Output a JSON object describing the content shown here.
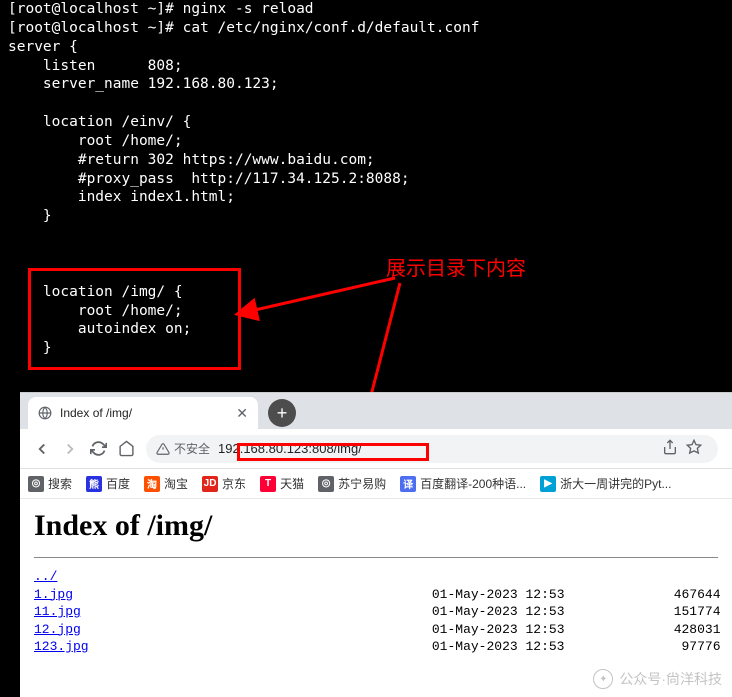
{
  "terminal": {
    "line0": "[root@localhost ~]# nginx -s reload",
    "prompt": "[root@localhost ~]# ",
    "command": "cat /etc/nginx/conf.d/default.conf",
    "config": "\nserver {\n    listen      808;\n    server_name 192.168.80.123;\n\n    location /einv/ {\n        root /home/;\n        #return 302 https://www.baidu.com;\n        #proxy_pass  http://117.34.125.2:8088;\n        index index1.html;\n    }\n\n\n\n    location /img/ {\n        root /home/;\n        autoindex on;\n    }"
  },
  "annotation": {
    "text": "展示目录下内容"
  },
  "browser": {
    "tab_title": "Index of /img/",
    "insecure_label": "不安全",
    "url": "192.168.80.123:808/img/",
    "bookmarks": [
      {
        "label": "搜索",
        "icon_bg": "#5f6368",
        "icon_txt": "◎"
      },
      {
        "label": "百度",
        "icon_bg": "#2932E1",
        "icon_txt": "熊"
      },
      {
        "label": "淘宝",
        "icon_bg": "#FF5000",
        "icon_txt": "淘"
      },
      {
        "label": "京东",
        "icon_bg": "#E1251B",
        "icon_txt": "JD"
      },
      {
        "label": "天猫",
        "icon_bg": "#FF0036",
        "icon_txt": "T"
      },
      {
        "label": "苏宁易购",
        "icon_bg": "#5f6368",
        "icon_txt": "◎"
      },
      {
        "label": "百度翻译-200种语...",
        "icon_bg": "#4E6EF2",
        "icon_txt": "译"
      },
      {
        "label": "浙大一周讲完的Pyt...",
        "icon_bg": "#00A1D6",
        "icon_txt": "▶"
      }
    ]
  },
  "index_page": {
    "heading": "Index of /img/",
    "parent": "../",
    "files": [
      {
        "name": "1.jpg",
        "date": "01-May-2023 12:53",
        "size": "467644"
      },
      {
        "name": "11.jpg",
        "date": "01-May-2023 12:53",
        "size": "151774"
      },
      {
        "name": "12.jpg",
        "date": "01-May-2023 12:53",
        "size": "428031"
      },
      {
        "name": "123.jpg",
        "date": "01-May-2023 12:53",
        "size": "97776"
      }
    ]
  },
  "watermark": {
    "text": "公众号·尙洋科技"
  }
}
